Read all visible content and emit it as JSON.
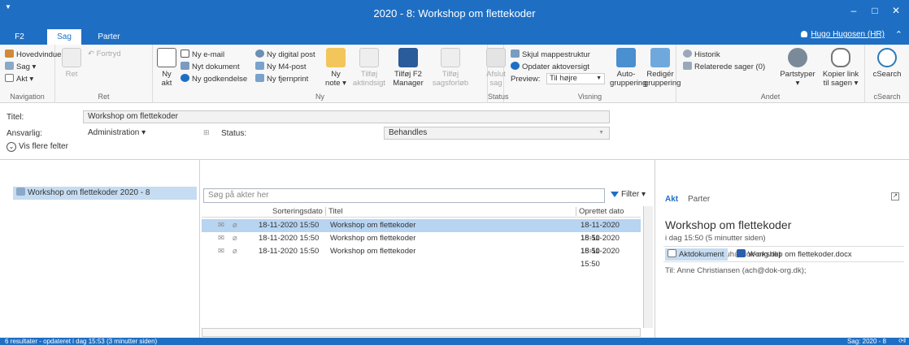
{
  "window": {
    "title": "2020 - 8: Workshop om flettekoder",
    "minimize": "–",
    "maximize": "□",
    "close": "✕"
  },
  "tabs": [
    {
      "label": "F2"
    },
    {
      "label": "Sag"
    },
    {
      "label": "Parter"
    }
  ],
  "user": "Hugo Hugosen (HR)",
  "ribbon": {
    "navigation": {
      "label": "Navigation",
      "items": [
        "Hovedvindue",
        "Sag ▾",
        "Akt ▾"
      ]
    },
    "ret": {
      "label": "Ret",
      "ret": "Ret",
      "fortryd": "Fortryd"
    },
    "ny": {
      "label": "Ny",
      "ny_akt": [
        "Ny",
        "akt"
      ],
      "items": [
        "Ny e-mail",
        "Nyt dokument",
        "Ny godkendelse",
        "Ny digital post",
        "Ny M4-post",
        "Ny fjernprint"
      ],
      "ny_note": [
        "Ny",
        "note ▾"
      ],
      "tilfoj_aktindsigt": [
        "Tilføj",
        "aktindsigt"
      ],
      "tilfoj_f2": [
        "Tilføj F2",
        "Manager"
      ],
      "tilfoj_sagsforlob": [
        "Tilføj",
        "sagsforløb"
      ]
    },
    "status": {
      "label": "Status",
      "afslut": [
        "Afslut",
        "sag"
      ]
    },
    "visning": {
      "label": "Visning",
      "skjul": "Skjul mappestruktur",
      "opdater": "Opdater aktoversigt",
      "preview_label": "Preview:",
      "preview_value": "Til højre",
      "auto": [
        "Auto-",
        "gruppering"
      ],
      "rediger": [
        "Redigér",
        "gruppering"
      ]
    },
    "andet": {
      "label": "Andet",
      "historik": "Historik",
      "relaterede": "Relaterede sager (0)",
      "partstyper": [
        "Partstyper",
        "▾"
      ],
      "kopier": [
        "Kopier link",
        "til sagen ▾"
      ]
    },
    "csearch": {
      "label": "cSearch",
      "btn": "cSearch"
    }
  },
  "fields": {
    "titel_label": "Titel:",
    "titel_value": "Workshop om flettekoder",
    "ansvarlig_label": "Ansvarlig:",
    "ansvarlig_value": "Administration ▾",
    "status_label": "Status:",
    "status_value": "Behandles",
    "vis_flere": "Vis flere felter"
  },
  "tree": {
    "item": "Workshop om flettekoder 2020 - 8"
  },
  "list": {
    "search_placeholder": "Søg på akter her",
    "filter": "Filter ▾",
    "columns": [
      "Sorteringsdato",
      "Titel",
      "Oprettet dato"
    ],
    "rows": [
      {
        "date": "18-11-2020 15:50",
        "title": "Workshop om flettekoder",
        "created": "18-11-2020 15:50"
      },
      {
        "date": "18-11-2020 15:50",
        "title": "Workshop om flettekoder",
        "created": "18-11-2020 15:50"
      },
      {
        "date": "18-11-2020 15:50",
        "title": "Workshop om flettekoder",
        "created": "18-11-2020 15:50"
      }
    ]
  },
  "detail": {
    "tab_akt": "Akt",
    "tab_parter": "Parter",
    "title": "Workshop om flettekoder",
    "time": "i dag 15:50 (5 minutter siden)",
    "from": "Hugo Hugosen (huh@dok-org.dk)",
    "til_label": "Til:",
    "til_value": "Anne Christiansen (ach@dok-org.dk);",
    "aktdokument": "Aktdokument",
    "docname": "Workshop om flettekoder.docx"
  },
  "statusbar": {
    "left": "6 resultater - opdateret i dag 15:53 (3 minutter siden)",
    "right": "Sag: 2020 - 8"
  }
}
